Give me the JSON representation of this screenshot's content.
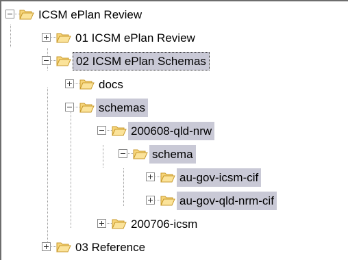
{
  "tree": {
    "nodes": [
      {
        "label": "ICSM ePlan Review",
        "expanded": true
      },
      {
        "label": "01 ICSM ePlan Review",
        "expanded": false
      },
      {
        "label": "02 ICSM ePlan Schemas",
        "expanded": true
      },
      {
        "label": "docs",
        "expanded": false
      },
      {
        "label": "schemas",
        "expanded": true
      },
      {
        "label": "200608-qld-nrw",
        "expanded": true
      },
      {
        "label": "schema",
        "expanded": true
      },
      {
        "label": "au-gov-icsm-cif",
        "expanded": false
      },
      {
        "label": "au-gov-qld-nrm-cif",
        "expanded": false
      },
      {
        "label": "200706-icsm",
        "expanded": false
      },
      {
        "label": "03 Reference",
        "expanded": false
      }
    ]
  },
  "colors": {
    "selection": "#c9c9d6",
    "folder_fill": "#f7d57a",
    "folder_stroke": "#c89a2c",
    "border": "#6d6d6d"
  },
  "icons": {
    "expand": "plus-box-icon",
    "collapse": "minus-box-icon",
    "folder": "open-folder-icon"
  }
}
